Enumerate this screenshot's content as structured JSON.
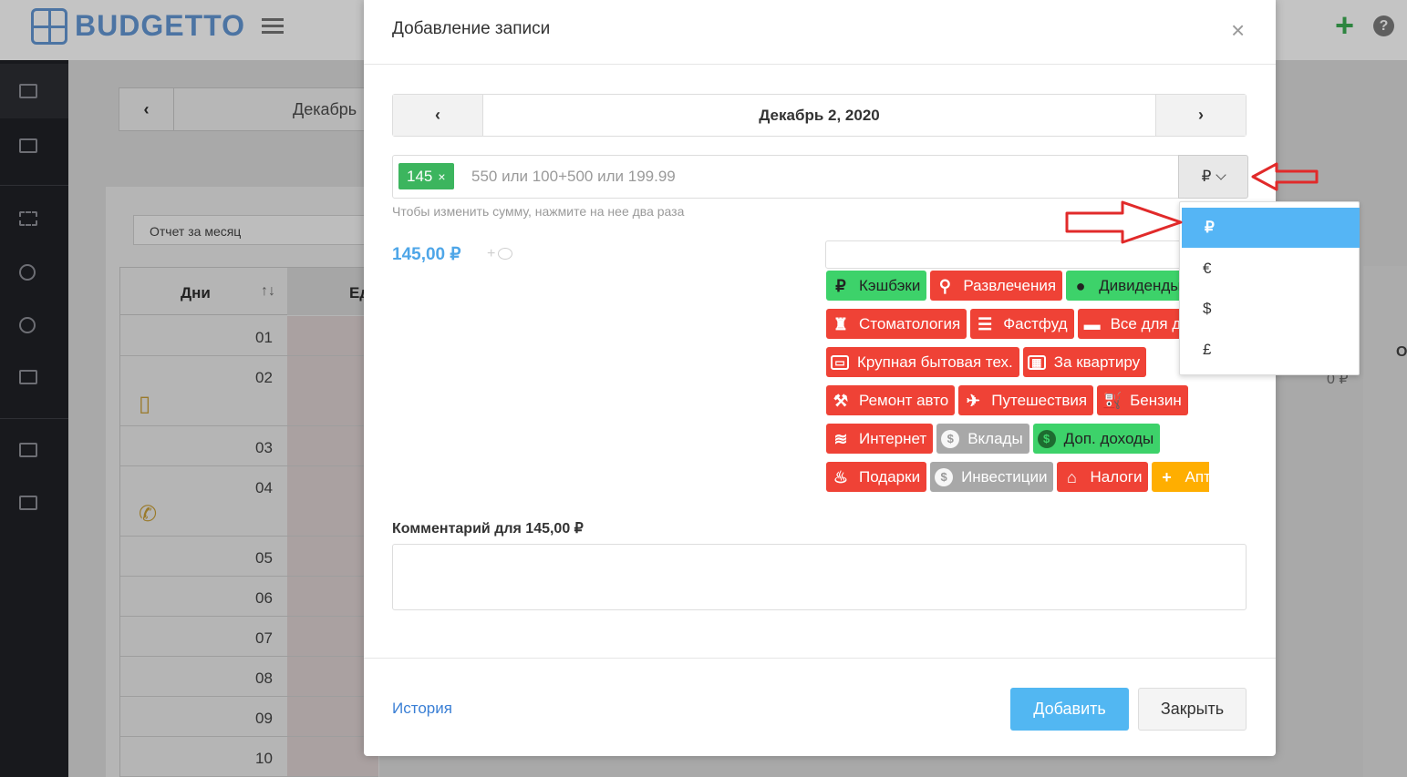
{
  "app": {
    "logo_text": "BUDGETTO",
    "bg_month_label": "Декабрь",
    "bg_report_select": "Отчет за месяц",
    "bg_table_header_days": "Дни",
    "bg_table_header_col2": "Ед",
    "bg_table_header_right": "О",
    "bg_right_value": "0 ₽",
    "bg_rows": [
      "01",
      "02",
      "03",
      "04",
      "05",
      "06",
      "07",
      "08",
      "09",
      "10"
    ]
  },
  "modal": {
    "title": "Добавление записи",
    "close_glyph": "×",
    "date_label": "Декабрь 2, 2020",
    "amount_tag": "145",
    "amount_tag_remove": "×",
    "amount_placeholder": "550 или 100+500 или 199.99",
    "currency": "₽",
    "hint": "Чтобы изменить сумму, нажмите на нее два раза",
    "total": "145,00 ₽",
    "add_comment_plus": "+",
    "comment_label": "Комментарий для 145,00 ₽",
    "history_link": "История",
    "add_button": "Добавить",
    "close_button": "Закрыть"
  },
  "categories": [
    [
      {
        "label": "Кэшбэки",
        "icon": "ruble-icon",
        "glyph": "₽",
        "color": "green"
      },
      {
        "label": "Развлечения",
        "icon": "bicycle-icon",
        "glyph": "⚲",
        "color": "red"
      },
      {
        "label": "Дивиденды",
        "icon": "piggy-bank-icon",
        "glyph": "●",
        "color": "green"
      }
    ],
    [
      {
        "label": "Стоматология",
        "icon": "tooth-icon",
        "glyph": "♜",
        "color": "red"
      },
      {
        "label": "Фастфуд",
        "icon": "burger-icon",
        "glyph": "☰",
        "color": "red"
      },
      {
        "label": "Все для дома",
        "icon": "sofa-icon",
        "glyph": "▬",
        "color": "red"
      }
    ],
    [
      {
        "label": "Крупная бытовая тех.",
        "icon": "monitor-icon",
        "glyph": "▭",
        "color": "red"
      },
      {
        "label": "За квартиру",
        "icon": "building-icon",
        "glyph": "▦",
        "color": "red"
      }
    ],
    [
      {
        "label": "Ремонт авто",
        "icon": "hammer-icon",
        "glyph": "⚒",
        "color": "red"
      },
      {
        "label": "Путешествия",
        "icon": "plane-icon",
        "glyph": "✈",
        "color": "red"
      },
      {
        "label": "Бензин",
        "icon": "fuel-can-icon",
        "glyph": "⛽",
        "color": "red"
      }
    ],
    [
      {
        "label": "Интернет",
        "icon": "wifi-icon",
        "glyph": "≋",
        "color": "red"
      },
      {
        "label": "Вклады",
        "icon": "coin-icon",
        "glyph": "$",
        "color": "gray"
      },
      {
        "label": "Доп. доходы",
        "icon": "coin-icon",
        "glyph": "$",
        "color": "green"
      }
    ],
    [
      {
        "label": "Подарки",
        "icon": "cake-icon",
        "glyph": "♨",
        "color": "red"
      },
      {
        "label": "Инвестиции",
        "icon": "coin-icon",
        "glyph": "$",
        "color": "gray"
      },
      {
        "label": "Налоги",
        "icon": "bank-icon",
        "glyph": "⌂",
        "color": "red"
      },
      {
        "label": "Аптеки",
        "icon": "pharmacy-icon",
        "glyph": "+",
        "color": "orange"
      }
    ]
  ],
  "currency_dropdown": {
    "options": [
      "₽",
      "€",
      "$",
      "£"
    ],
    "selected": "₽"
  },
  "colors": {
    "accent_blue": "#55b5f5",
    "category_red": "#ef4236",
    "category_green": "#3dd26a",
    "category_gray": "#a8a8a8",
    "category_orange": "#ffae00",
    "annotation_arrow": "#e12a2a"
  }
}
